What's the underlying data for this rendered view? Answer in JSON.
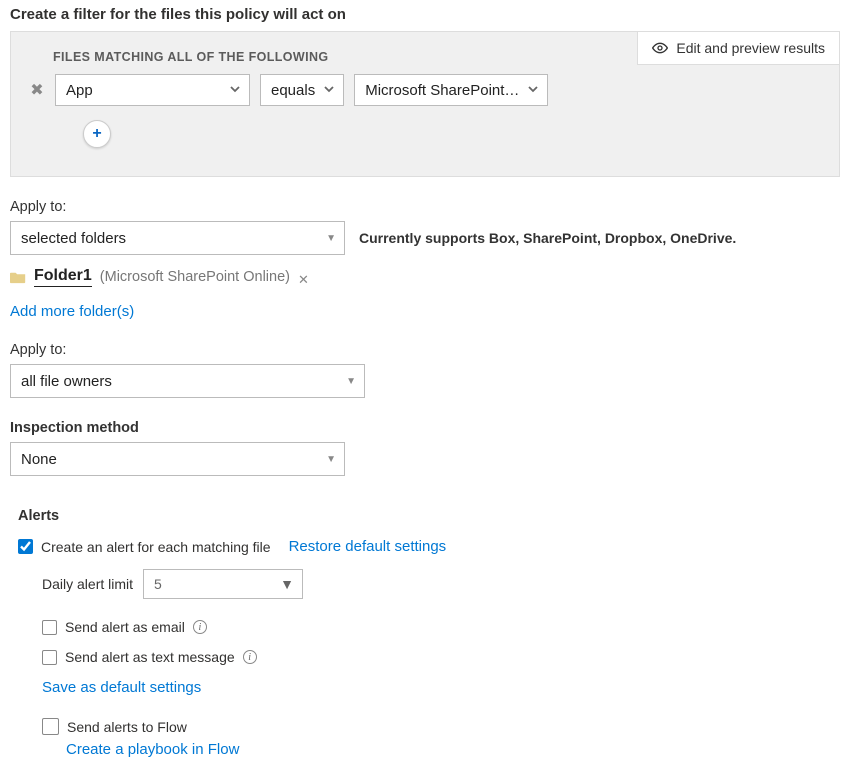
{
  "header": {
    "title": "Create a filter for the files this policy will act on"
  },
  "filter": {
    "caption": "FILES MATCHING ALL OF THE FOLLOWING",
    "edit_preview_label": "Edit and preview results",
    "row": {
      "field": "App",
      "operator": "equals",
      "value": "Microsoft SharePoint…"
    }
  },
  "apply_folders": {
    "label": "Apply to:",
    "value": "selected folders",
    "hint": "Currently supports Box, SharePoint, Dropbox, OneDrive.",
    "folder": {
      "name": "Folder1",
      "source": "(Microsoft SharePoint Online)"
    },
    "add_more": "Add more folder(s)"
  },
  "apply_owners": {
    "label": "Apply to:",
    "value": "all file owners"
  },
  "inspection": {
    "label": "Inspection method",
    "value": "None"
  },
  "alerts": {
    "heading": "Alerts",
    "create_alert_label": "Create an alert for each matching file",
    "create_alert_checked": true,
    "restore_defaults": "Restore default settings",
    "daily_limit_label": "Daily alert limit",
    "daily_limit_value": "5",
    "send_email_label": "Send alert as email",
    "send_email_checked": false,
    "send_text_label": "Send alert as text message",
    "send_text_checked": false,
    "save_defaults": "Save as default settings",
    "send_flow_label": "Send alerts to Flow",
    "send_flow_checked": false,
    "create_playbook": "Create a playbook in Flow"
  }
}
